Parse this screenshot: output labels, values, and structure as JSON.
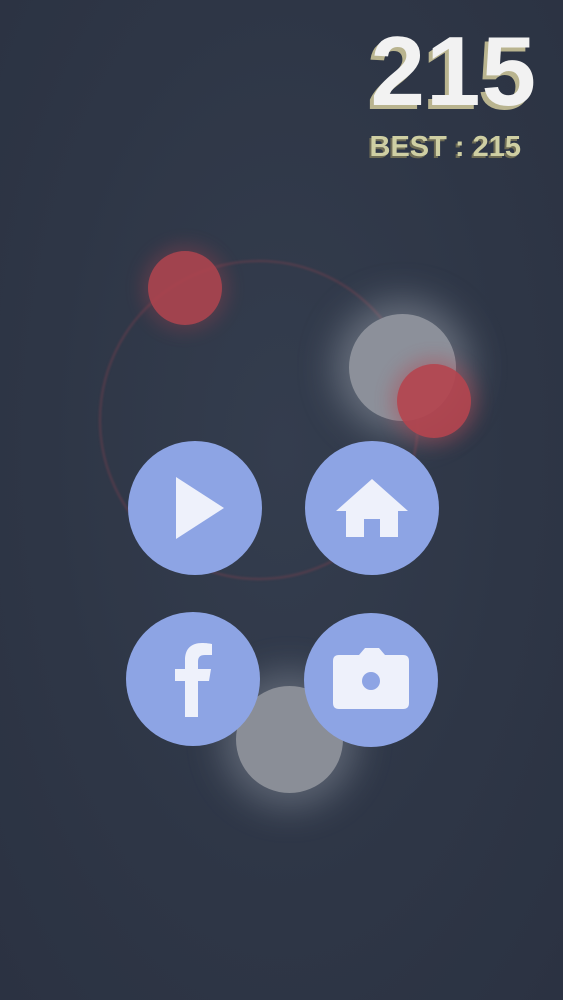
{
  "hud": {
    "score": "215",
    "best_label": "BEST : 215"
  },
  "menu": {
    "buttons": [
      {
        "name": "play",
        "icon": "play-icon"
      },
      {
        "name": "home",
        "icon": "home-icon"
      },
      {
        "name": "facebook",
        "icon": "facebook-icon"
      },
      {
        "name": "screenshot",
        "icon": "camera-icon"
      }
    ]
  },
  "colors": {
    "background": "#2f3747",
    "button": "#8da4e4",
    "icon": "#eef1fb",
    "score": "#f2f2f2",
    "score_shadow": "#b9b48f",
    "best": "#cfcfa3",
    "red_ball": "#b5454f",
    "white_ball": "#8c909a"
  }
}
